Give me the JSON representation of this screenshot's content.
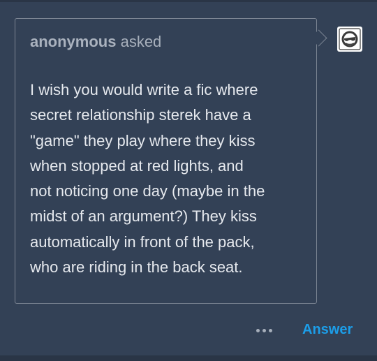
{
  "ask": {
    "asker_name": "anonymous",
    "asked_word": " asked",
    "question": "I wish you would write a fic where\nsecret relationship sterek have a\n\"game\" they play where they kiss\nwhen stopped at red lights, and\nnot noticing one day (maybe in the\nmidst of an argument?) They kiss\nautomatically in front of the pack,\nwho are riding in the back seat."
  },
  "footer": {
    "more_icon": "ellipsis-icon",
    "answer_label": "Answer"
  },
  "colors": {
    "background": "#334156",
    "answer_accent": "#1c9ee9",
    "bubble_border": "#7c8593"
  }
}
